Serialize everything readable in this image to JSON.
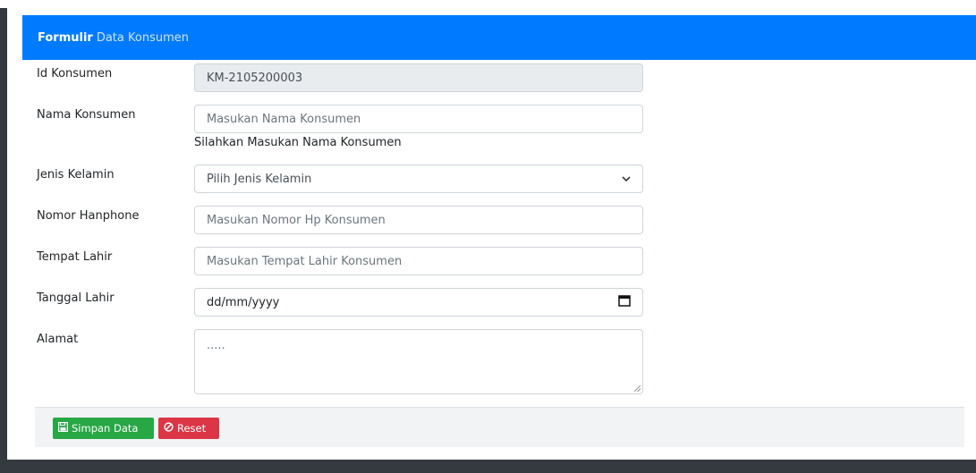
{
  "header": {
    "bold": "Formulir",
    "rest": "Data Konsumen"
  },
  "fields": {
    "id": {
      "label": "Id Konsumen",
      "value": "KM-2105200003"
    },
    "nama": {
      "label": "Nama Konsumen",
      "placeholder": "Masukan Nama Konsumen",
      "help": "Silahkan Masukan Nama Konsumen"
    },
    "jenis_kelamin": {
      "label": "Jenis Kelamin",
      "selected": "Pilih Jenis Kelamin"
    },
    "hp": {
      "label": "Nomor Hanphone",
      "placeholder": "Masukan Nomor Hp Konsumen"
    },
    "tempat_lahir": {
      "label": "Tempat Lahir",
      "placeholder": "Masukan Tempat Lahir Konsumen"
    },
    "tanggal_lahir": {
      "label": "Tanggal Lahir",
      "placeholder": "dd/mm/yyyy"
    },
    "alamat": {
      "label": "Alamat",
      "placeholder": "....."
    }
  },
  "buttons": {
    "save": "Simpan Data",
    "reset": "Reset"
  },
  "colors": {
    "primary": "#007bff",
    "success": "#28a745",
    "danger": "#dc3545"
  },
  "icons": {
    "save": "floppy-disk-icon",
    "reset": "ban-icon",
    "calendar": "calendar-icon",
    "dropdown": "chevron-down-icon"
  }
}
